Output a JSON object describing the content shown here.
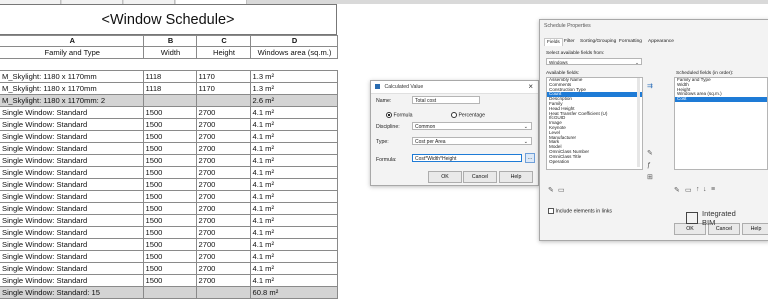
{
  "schedule": {
    "title": "<Window Schedule>",
    "col_letters": [
      "A",
      "B",
      "C",
      "D"
    ],
    "col_names": [
      "Family and Type",
      "Width",
      "Height",
      "Windows area (sq.m.)"
    ],
    "rows": [
      {
        "type": "spacer",
        "cells": [
          "",
          "",
          "",
          ""
        ]
      },
      {
        "type": "data",
        "cells": [
          "M_Skylight: 1180 x 1170mm",
          "1118",
          "1170",
          "1.3 m²"
        ]
      },
      {
        "type": "data",
        "cells": [
          "M_Skylight: 1180 x 1170mm",
          "1118",
          "1170",
          "1.3 m²"
        ]
      },
      {
        "type": "total",
        "cells": [
          "M_Skylight: 1180 x 1170mm: 2",
          "",
          "",
          "2.6 m²"
        ]
      },
      {
        "type": "data",
        "cells": [
          "Single Window: Standard",
          "1500",
          "2700",
          "4.1 m²"
        ]
      },
      {
        "type": "data",
        "cells": [
          "Single Window: Standard",
          "1500",
          "2700",
          "4.1 m²"
        ]
      },
      {
        "type": "data",
        "cells": [
          "Single Window: Standard",
          "1500",
          "2700",
          "4.1 m²"
        ]
      },
      {
        "type": "data",
        "cells": [
          "Single Window: Standard",
          "1500",
          "2700",
          "4.1 m²"
        ]
      },
      {
        "type": "data",
        "cells": [
          "Single Window: Standard",
          "1500",
          "2700",
          "4.1 m²"
        ]
      },
      {
        "type": "data",
        "cells": [
          "Single Window: Standard",
          "1500",
          "2700",
          "4.1 m²"
        ]
      },
      {
        "type": "data",
        "cells": [
          "Single Window: Standard",
          "1500",
          "2700",
          "4.1 m²"
        ]
      },
      {
        "type": "data",
        "cells": [
          "Single Window: Standard",
          "1500",
          "2700",
          "4.1 m²"
        ]
      },
      {
        "type": "data",
        "cells": [
          "Single Window: Standard",
          "1500",
          "2700",
          "4.1 m²"
        ]
      },
      {
        "type": "data",
        "cells": [
          "Single Window: Standard",
          "1500",
          "2700",
          "4.1 m²"
        ]
      },
      {
        "type": "data",
        "cells": [
          "Single Window: Standard",
          "1500",
          "2700",
          "4.1 m²"
        ]
      },
      {
        "type": "data",
        "cells": [
          "Single Window: Standard",
          "1500",
          "2700",
          "4.1 m²"
        ]
      },
      {
        "type": "data",
        "cells": [
          "Single Window: Standard",
          "1500",
          "2700",
          "4.1 m²"
        ]
      },
      {
        "type": "data",
        "cells": [
          "Single Window: Standard",
          "1500",
          "2700",
          "4.1 m²"
        ]
      },
      {
        "type": "data",
        "cells": [
          "Single Window: Standard",
          "1500",
          "2700",
          "4.1 m²"
        ]
      },
      {
        "type": "grand",
        "cells": [
          "Single Window: Standard: 15",
          "",
          "",
          "60.8 m²"
        ]
      }
    ]
  },
  "calc": {
    "title": "Calculated Value",
    "close": "×",
    "name_label": "Name:",
    "name_value": "Total cost",
    "formula_option": "Formula",
    "percentage_option": "Percentage",
    "discipline_label": "Discipline:",
    "discipline_value": "Common",
    "type_label": "Type:",
    "type_value": "Cost per Area",
    "formula_label": "Formula:",
    "formula_value": "Cost*Width*Height",
    "ok": "OK",
    "cancel": "Cancel",
    "help": "Help"
  },
  "props": {
    "title": "Schedule Properties",
    "tabs": [
      "Fields",
      "Filter",
      "Sorting/Grouping",
      "Formatting",
      "Appearance"
    ],
    "select_from_label": "Select available fields from:",
    "select_from_value": "Windows",
    "available_label": "Available fields:",
    "available": [
      "Assembly Name",
      "Comments",
      "Construction Type",
      "Count",
      "Description",
      "Family",
      "Head Height",
      "Heat Transfer Coefficient (U)",
      "IfcGUID",
      "Image",
      "Keynote",
      "Level",
      "Manufacturer",
      "Mark",
      "Model",
      "OmniClass Number",
      "OmniClass Title",
      "Operation"
    ],
    "available_selected": 3,
    "scheduled_label": "Scheduled fields (in order):",
    "scheduled": [
      "Family and Type",
      "Width",
      "Height",
      "Windows area (sq.m.)",
      "Cost"
    ],
    "scheduled_selected": 4,
    "include_links": "Include elements in links",
    "ok": "OK",
    "cancel": "Cancel",
    "help": "Help"
  },
  "logo": {
    "line1": "Integrated",
    "line2": "BIM"
  }
}
